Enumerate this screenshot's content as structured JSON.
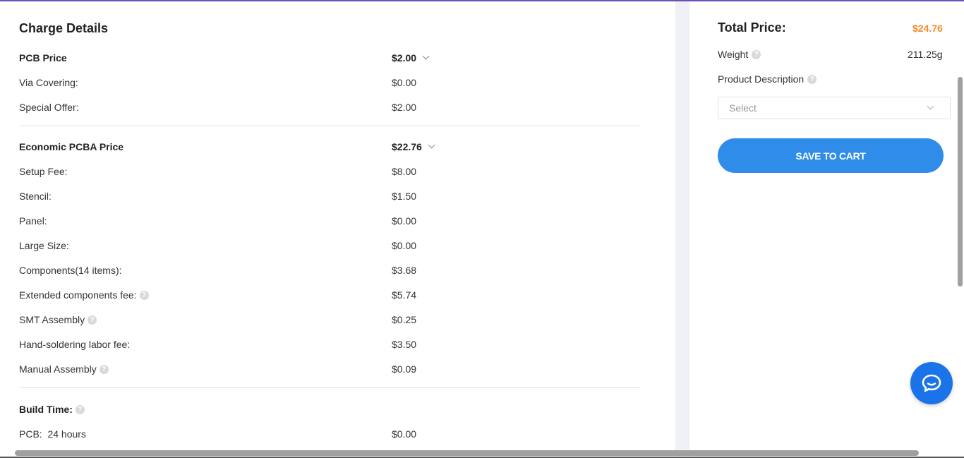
{
  "charge_details": {
    "title": "Charge Details",
    "pcb": {
      "label": "PCB Price",
      "value": "$2.00",
      "items": [
        {
          "label": "Via Covering:",
          "value": "$0.00"
        },
        {
          "label": "Special Offer:",
          "value": "$2.00"
        }
      ]
    },
    "pcba": {
      "label": "Economic PCBA Price",
      "value": "$22.76",
      "items": [
        {
          "label": "Setup Fee:",
          "value": "$8.00"
        },
        {
          "label": "Stencil:",
          "value": "$1.50"
        },
        {
          "label": "Panel:",
          "value": "$0.00"
        },
        {
          "label": "Large Size:",
          "value": "$0.00"
        },
        {
          "label": "Components(14 items):",
          "value": "$3.68"
        },
        {
          "label": "Extended components fee:",
          "value": "$5.74"
        },
        {
          "label": "SMT Assembly",
          "value": "$0.25"
        },
        {
          "label": "Hand-soldering labor fee:",
          "value": "$3.50"
        },
        {
          "label": "Manual Assembly",
          "value": "$0.09"
        }
      ]
    },
    "build_time": {
      "label": "Build Time:",
      "items": [
        {
          "label": "PCB:  24 hours",
          "value": "$0.00"
        }
      ]
    }
  },
  "summary": {
    "total_label": "Total Price:",
    "total_value": "$24.76",
    "weight_label": "Weight",
    "weight_value": "211.25g",
    "product_description_label": "Product Description",
    "select_placeholder": "Select",
    "save_button": "SAVE TO CART"
  },
  "help_glyph": "?",
  "colors": {
    "accent_blue": "#2f8ce8",
    "total_orange": "#f68a2b",
    "top_border": "#6b4fbb",
    "chat_blue": "#1a73e8"
  }
}
